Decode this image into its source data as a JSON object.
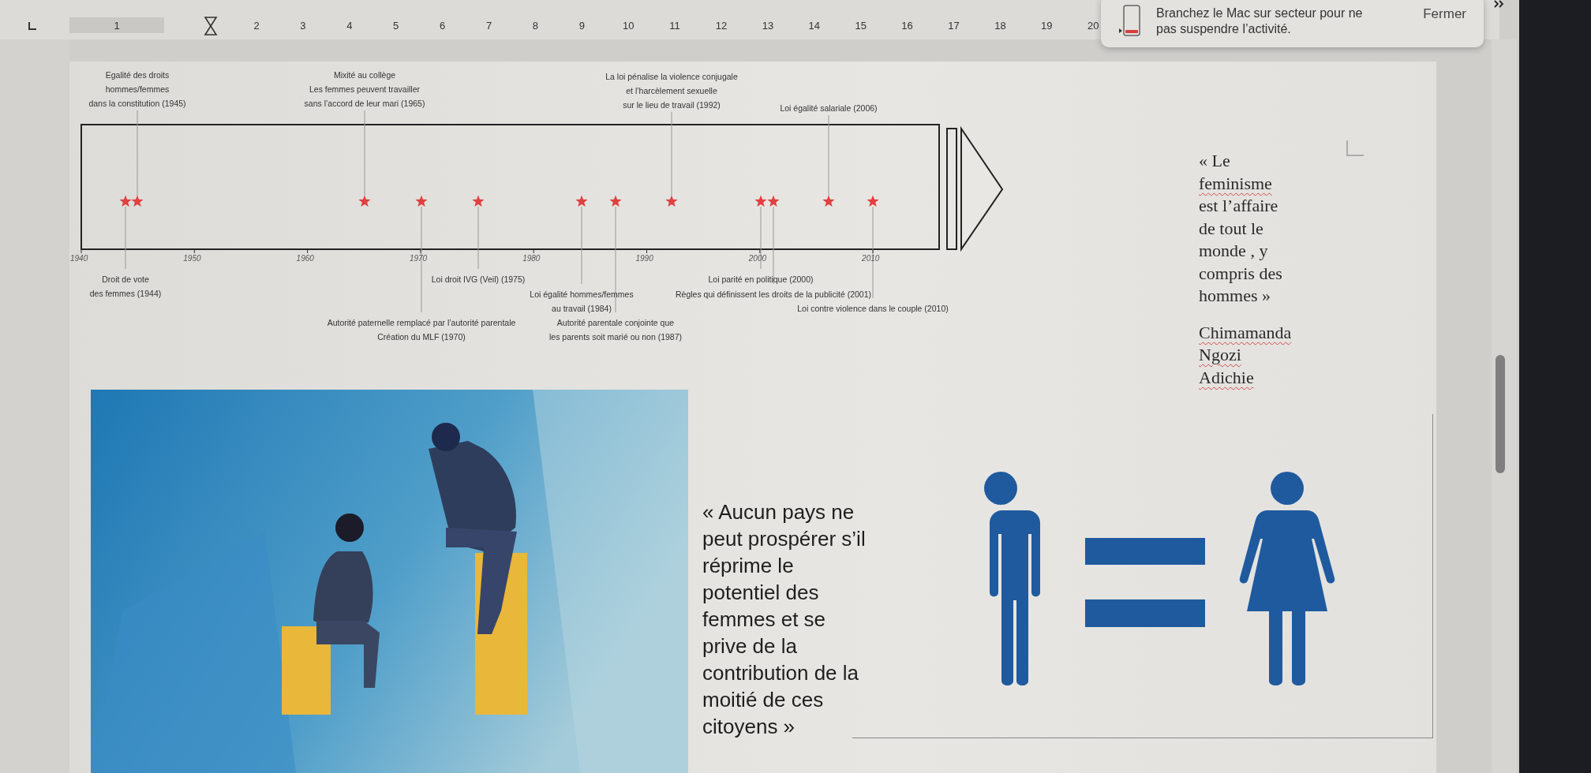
{
  "ruler": {
    "numbers": [
      "1",
      "2",
      "3",
      "4",
      "5",
      "6",
      "7",
      "8",
      "9",
      "10",
      "11",
      "12",
      "13",
      "14",
      "15",
      "16",
      "17",
      "18",
      "19",
      "20"
    ]
  },
  "notification": {
    "lines": [
      "Branchez le Mac sur secteur pour ne",
      "pas suspendre l’activité."
    ],
    "button": "Fermer"
  },
  "timeline": {
    "axis_labels": [
      "1940",
      "1950",
      "1960",
      "1970",
      "1980",
      "1990",
      "2000",
      "2010"
    ],
    "events": [
      {
        "lines": [
          "Egalité des droits",
          "hommes/femmes",
          "dans la constitution (1945)"
        ]
      },
      {
        "lines": [
          "Mixité au collège",
          "Les femmes peuvent travailler",
          "sans l’accord de leur mari (1965)"
        ]
      },
      {
        "lines": [
          "La loi pénalise la violence conjugale",
          "et l’harcèlement sexuelle",
          "sur le lieu de travail (1992)"
        ]
      },
      {
        "lines": [
          "Loi égalité salariale (2006)"
        ]
      },
      {
        "lines": [
          "Droit de vote",
          "des femmes (1944)"
        ]
      },
      {
        "lines": [
          "Loi droit IVG (Veil) (1975)"
        ]
      },
      {
        "lines": [
          "Loi parité en politique (2000)"
        ]
      },
      {
        "lines": [
          "Loi égalité hommes/femmes",
          "au travail (1984)"
        ]
      },
      {
        "lines": [
          "Règles qui définissent les droits de la publicité (2001)"
        ]
      },
      {
        "lines": [
          "Loi contre violence dans le couple (2010)"
        ]
      },
      {
        "lines": [
          "Autorité paternelle remplacé par l’autorité parentale",
          "Création du MLF (1970)"
        ]
      },
      {
        "lines": [
          "Autorité parentale conjointe que",
          "les parents soit marié ou non (1987)"
        ]
      }
    ]
  },
  "quote": {
    "lines": [
      {
        "text": "« Le",
        "misspelled": false
      },
      {
        "text": "feminisme",
        "misspelled": true
      },
      {
        "text": "est l’affaire",
        "misspelled": false
      },
      {
        "text": "de tout le",
        "misspelled": false
      },
      {
        "text": "monde , y",
        "misspelled": false
      },
      {
        "text": "compris des",
        "misspelled": false
      },
      {
        "text": "hommes »",
        "misspelled": false
      }
    ],
    "author": [
      {
        "text": "Chimamanda",
        "misspelled": true
      },
      {
        "text": "Ngozi",
        "misspelled": true
      },
      {
        "text": "Adichie",
        "misspelled": true
      }
    ]
  },
  "caption": {
    "lines": [
      "« Aucun pays ne",
      "peut prospérer s’il",
      "réprime le",
      "potentiel des",
      "femmes et se",
      "prive de la",
      "contribution de la",
      "moitié de ces",
      "citoyens  »"
    ]
  }
}
